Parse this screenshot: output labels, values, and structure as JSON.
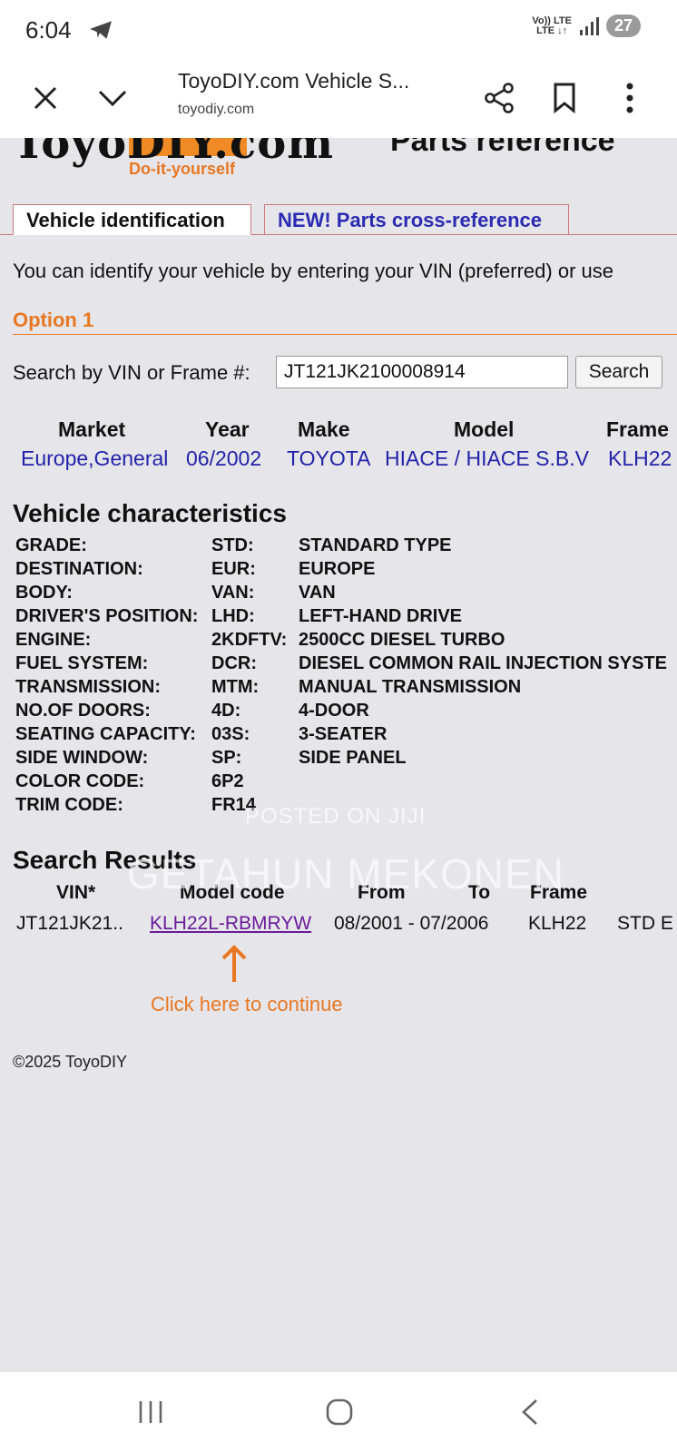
{
  "status_bar": {
    "time": "6:04",
    "net_top": "Vo)) LTE",
    "net_bottom": "LTE ↓↑",
    "battery": "27"
  },
  "browser": {
    "title": "ToyoDIY.com Vehicle S...",
    "domain": "toyodiy.com"
  },
  "header": {
    "logo_text": "ToyoDIY.com",
    "logo_tagline": "Do-it-yourself",
    "parts_reference": "Parts reference"
  },
  "tabs": [
    {
      "label": "Vehicle identification"
    },
    {
      "label": "NEW! Parts cross-reference"
    }
  ],
  "intro_text": "You can identify your vehicle by entering your VIN (preferred) or use",
  "option": {
    "title": "Option 1"
  },
  "search": {
    "label": "Search by VIN or Frame #:",
    "value": "JT121JK2100008914",
    "button": "Search"
  },
  "vehicle_table": {
    "headers": [
      "Market",
      "Year",
      "Make",
      "Model",
      "Frame"
    ],
    "values": [
      "Europe,General",
      "06/2002",
      "TOYOTA",
      "HIACE / HIACE S.B.V",
      "KLH22"
    ]
  },
  "characteristics": {
    "title": "Vehicle characteristics",
    "rows": [
      [
        "GRADE:",
        "STD:",
        "STANDARD TYPE"
      ],
      [
        "DESTINATION:",
        "EUR:",
        "EUROPE"
      ],
      [
        "BODY:",
        "VAN:",
        "VAN"
      ],
      [
        "DRIVER'S POSITION:",
        "LHD:",
        "LEFT-HAND DRIVE"
      ],
      [
        "ENGINE:",
        "2KDFTV:",
        "2500CC DIESEL TURBO"
      ],
      [
        "FUEL SYSTEM:",
        "DCR:",
        "DIESEL COMMON RAIL INJECTION SYSTE"
      ],
      [
        "TRANSMISSION:",
        "MTM:",
        "MANUAL TRANSMISSION"
      ],
      [
        "NO.OF DOORS:",
        "4D:",
        "4-DOOR"
      ],
      [
        "SEATING CAPACITY:",
        "03S:",
        "3-SEATER"
      ],
      [
        "SIDE WINDOW:",
        "SP:",
        "SIDE PANEL"
      ],
      [
        "COLOR CODE:",
        "6P2",
        ""
      ],
      [
        "TRIM CODE:",
        "FR14",
        ""
      ]
    ]
  },
  "results": {
    "title": "Search Results",
    "headers": [
      "VIN*",
      "Model code",
      "From",
      "To",
      "Frame"
    ],
    "row": {
      "vin": "JT121JK21..",
      "model_code": "KLH22L-RBMRYW",
      "from_to": "08/2001 - 07/2006",
      "frame": "KLH22",
      "extra": "STD E"
    },
    "continue_text": "Click here to continue"
  },
  "footer": {
    "copyright": "©2025 ToyoDIY"
  },
  "watermark": {
    "line1": "POSTED ON JIJI",
    "line2": "GETAHUN MEKONEN"
  },
  "colors": {
    "accent_orange": "#e87722",
    "link_blue": "#2222aa",
    "visited_purple": "#6a1b9a"
  }
}
